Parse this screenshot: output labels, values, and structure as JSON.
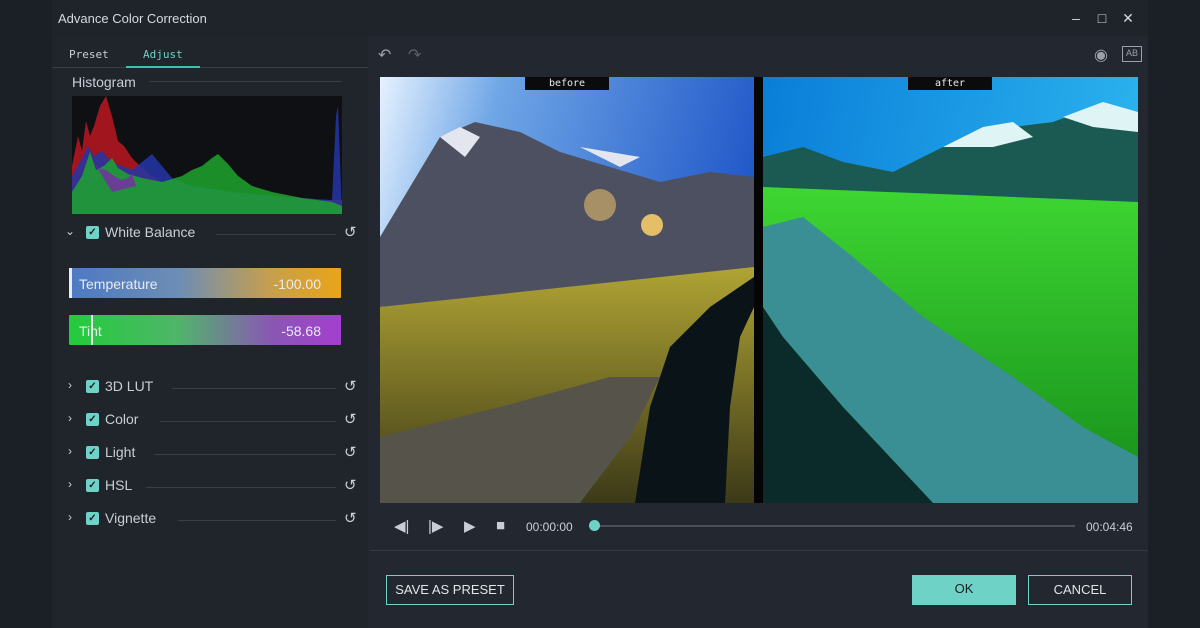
{
  "window": {
    "title": "Advance Color Correction",
    "minimize": "–",
    "maximize": "□",
    "close": "✕"
  },
  "tabs": [
    {
      "label": "Preset",
      "active": false
    },
    {
      "label": "Adjust",
      "active": true
    }
  ],
  "histogram": {
    "label": "Histogram"
  },
  "white_balance": {
    "label": "White Balance",
    "expanded": true,
    "checked": true,
    "temperature": {
      "label": "Temperature",
      "value": "-100.00"
    },
    "tint": {
      "label": "Tint",
      "value": "-58.68"
    }
  },
  "sections": [
    {
      "label": "3D LUT",
      "checked": true
    },
    {
      "label": "Color",
      "checked": true
    },
    {
      "label": "Light",
      "checked": true
    },
    {
      "label": "HSL",
      "checked": true
    },
    {
      "label": "Vignette",
      "checked": true
    }
  ],
  "preview": {
    "before_label": "before",
    "after_label": "after"
  },
  "playback": {
    "current_time": "00:00:00",
    "total_time": "00:04:46",
    "progress": 0
  },
  "buttons": {
    "save_preset": "SAVE AS PRESET",
    "ok": "OK",
    "cancel": "CANCEL"
  },
  "colors": {
    "accent": "#6fd2c6",
    "panel": "#20242b"
  }
}
